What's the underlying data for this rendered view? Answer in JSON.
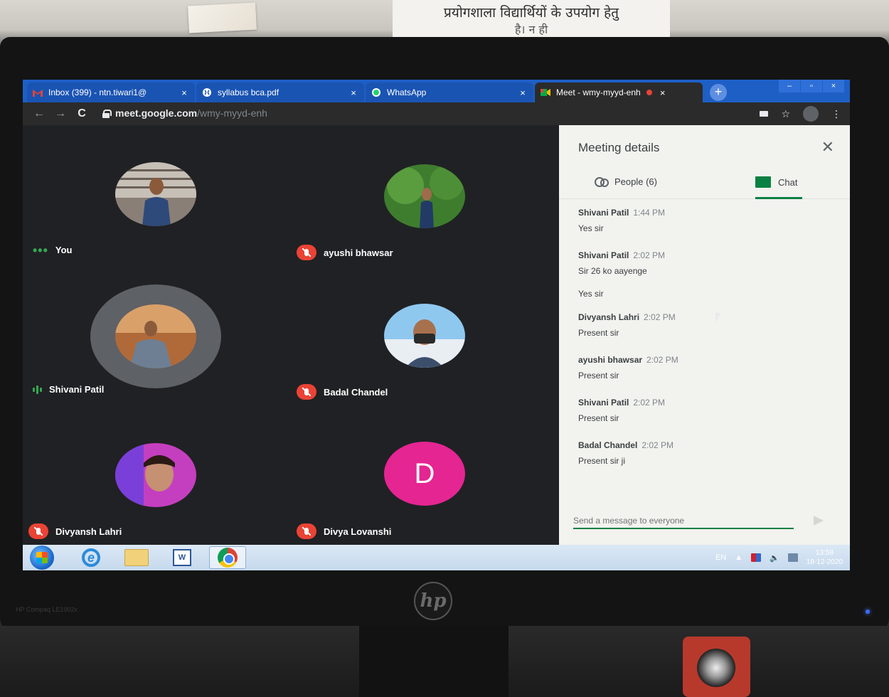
{
  "wall": {
    "notice_line1": "प्रयोगशाला विद्यार्थियों के उपयोग हेतु",
    "notice_line2": "है। न ही"
  },
  "browser": {
    "tabs": [
      {
        "title": "Inbox (399) - ntn.tiwari1@",
        "icon": "gmail-icon",
        "active": false
      },
      {
        "title": "syllabus bca.pdf",
        "icon": "globe-icon",
        "active": false
      },
      {
        "title": "WhatsApp",
        "icon": "whatsapp-icon",
        "active": false
      },
      {
        "title": "Meet - wmy-myyd-enh",
        "icon": "meet-icon",
        "active": true
      }
    ],
    "tab_close": "×",
    "new_tab": "+",
    "window_controls": [
      "–",
      "▫",
      "×"
    ],
    "url_host": "meet.google.com",
    "url_path": "/wmy-myyd-enh"
  },
  "meet": {
    "participants": [
      {
        "name": "You",
        "status": "talking-dots",
        "avatar": "photo"
      },
      {
        "name": "ayushi bhawsar",
        "status": "muted",
        "avatar": "photo"
      },
      {
        "name": "Shivani Patil",
        "status": "speaking",
        "avatar": "photo"
      },
      {
        "name": "Badal Chandel",
        "status": "muted",
        "avatar": "photo"
      },
      {
        "name": "Divyansh Lahri",
        "status": "muted",
        "avatar": "photo"
      },
      {
        "name": "Divya Lovanshi",
        "status": "muted",
        "avatar": "letter",
        "letter": "D"
      }
    ],
    "panel": {
      "title": "Meeting details",
      "people_tab": "People (6)",
      "chat_tab": "Chat",
      "messages": [
        {
          "sender": "Shivani Patil",
          "time": "1:44 PM",
          "text": "Yes sir"
        },
        {
          "sender": "Shivani Patil",
          "time": "2:02 PM",
          "text": "Sir 26 ko aayenge",
          "extra": "Yes sir"
        },
        {
          "sender": "Divyansh Lahri",
          "time": "2:02 PM",
          "text": "Present sir"
        },
        {
          "sender": "ayushi bhawsar",
          "time": "2:02 PM",
          "text": "Present sir"
        },
        {
          "sender": "Shivani Patil",
          "time": "2:02 PM",
          "text": "Present sir"
        },
        {
          "sender": "Badal Chandel",
          "time": "2:02 PM",
          "text": "Present sir ji"
        }
      ],
      "compose_placeholder": "Send a message to everyone"
    }
  },
  "taskbar": {
    "apps": [
      "start-orb",
      "ie-icon",
      "folder-icon",
      "word-icon",
      "chrome-icon"
    ],
    "word_label": "W",
    "language": "EN",
    "time": "13:58",
    "date": "18-12-2020"
  },
  "monitor": {
    "model_label": "HP Compaq LE1902x",
    "logo": "hp"
  }
}
